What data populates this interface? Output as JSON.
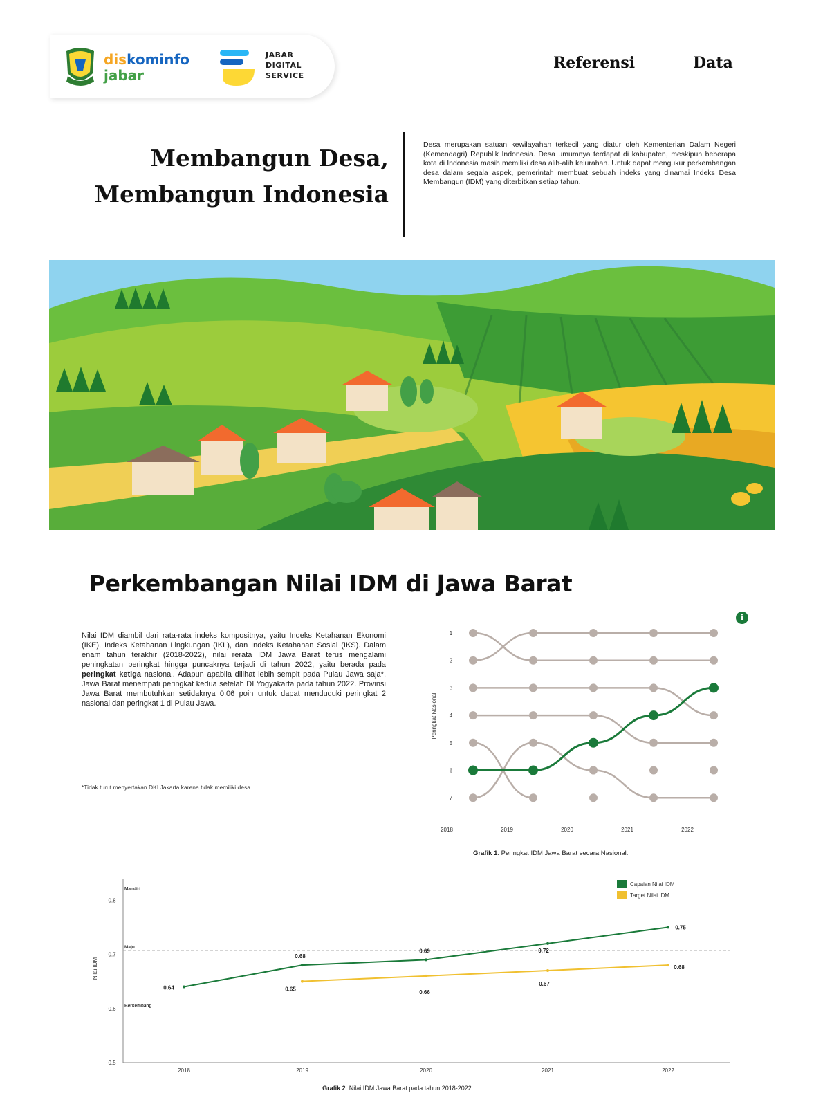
{
  "header": {
    "diskominfo_dis": "dis",
    "diskominfo_kominfo": "kominfo",
    "diskominfo_jabar": "jabar",
    "jds_line1": "JABAR",
    "jds_line2": "DIGITAL",
    "jds_line3": "SERVICE",
    "nav": [
      "Referensi",
      "Data"
    ]
  },
  "hero": {
    "title_line1": "Membangun Desa,",
    "title_line2": "Membangun Indonesia",
    "description": "Desa merupakan satuan kewilayahan terkecil yang diatur oleh Kementerian Dalam Negeri (Kemendagri) Republik Indonesia. Desa umumnya terdapat di kabupaten, meskipun beberapa kota di Indonesia masih memiliki desa alih-alih kelurahan. Untuk dapat mengukur perkembangan desa dalam segala aspek, pemerintah membuat sebuah indeks yang dinamai Indeks Desa Membangun (IDM) yang diterbitkan setiap tahun."
  },
  "section": {
    "title": "Perkembangan Nilai IDM di Jawa Barat",
    "text_parts": {
      "a": "Nilai IDM diambil dari rata-rata indeks kompositnya, yaitu Indeks Ketahanan Ekonomi (IKE), Indeks Ketahanan Lingkungan (IKL), dan Indeks Ketahanan Sosial (IKS). Dalam enam tahun terakhir (2018-2022), nilai rerata IDM Jawa Barat terus mengalami peningkatan peringkat hingga puncaknya terjadi di tahun 2022, yaitu berada pada ",
      "bold": "peringkat ketiga",
      "b": " nasional. Adapun apabila dilihat lebih sempit pada Pulau Jawa saja*, Jawa Barat menempati peringkat kedua setelah DI Yogyakarta pada tahun 2022. Provinsi Jawa Barat membutuhkan setidaknya 0.06 poin untuk dapat menduduki peringkat 2 nasional dan peringkat 1 di Pulau Jawa."
    },
    "footnote": "*Tidak turut menyertakan DKI Jakarta karena tidak memiliki desa",
    "info_icon": "i"
  },
  "chart_data": [
    {
      "type": "line",
      "subtype": "bump",
      "ylabel": "Peringkat Nasional",
      "x": [
        "2018",
        "2019",
        "2020",
        "2021",
        "2022"
      ],
      "y_ticks": [
        "1",
        "2",
        "3",
        "4",
        "5",
        "6",
        "7"
      ],
      "highlight_series": {
        "values": [
          6,
          6,
          5,
          4,
          3
        ],
        "color": "#1a7a3a"
      },
      "other_series": [
        {
          "values": [
            1,
            2,
            2,
            2,
            2
          ]
        },
        {
          "values": [
            2,
            1,
            1,
            1,
            1
          ]
        },
        {
          "values": [
            3,
            3,
            3,
            3,
            4
          ]
        },
        {
          "values": [
            4,
            4,
            4,
            5,
            5
          ]
        },
        {
          "values": [
            5,
            7,
            null,
            null,
            null
          ]
        },
        {
          "values": [
            7,
            5,
            6,
            7,
            7
          ]
        }
      ],
      "empty_points": [
        [
          2,
          6
        ],
        [
          2,
          7
        ],
        [
          3,
          6
        ],
        [
          4,
          6
        ]
      ],
      "other_color": "#b9aea8",
      "caption_bold": "Grafik 1",
      "caption_rest": ". Peringkat IDM Jawa Barat secara Nasional."
    },
    {
      "type": "line",
      "ylabel": "Nilai IDM",
      "x": [
        "2018",
        "2019",
        "2020",
        "2021",
        "2022"
      ],
      "y_ticks": [
        "0.5",
        "0.6",
        "0.7",
        "0.8"
      ],
      "ylim": [
        0.5,
        0.84
      ],
      "series": [
        {
          "name": "Capaian Nilai IDM",
          "color": "#1a7a3a",
          "values": [
            0.64,
            0.68,
            0.69,
            0.72,
            0.75
          ],
          "labels": [
            "0.64",
            "0.68",
            "0.69",
            "0.72",
            "0.75"
          ]
        },
        {
          "name": "Target Nilai IDM",
          "color": "#f0c030",
          "values": [
            null,
            0.65,
            0.66,
            0.67,
            0.68
          ],
          "labels": [
            "",
            "0.65",
            "0.66",
            "0.67",
            "0.68"
          ]
        }
      ],
      "reference_lines": [
        {
          "value": 0.815,
          "label": "Mandiri"
        },
        {
          "value": 0.707,
          "label": "Maju"
        },
        {
          "value": 0.599,
          "label": "Berkembang"
        }
      ],
      "caption_bold": "Grafik 2",
      "caption_rest": ". Nilai IDM Jawa Barat pada tahun 2018-2022"
    }
  ]
}
